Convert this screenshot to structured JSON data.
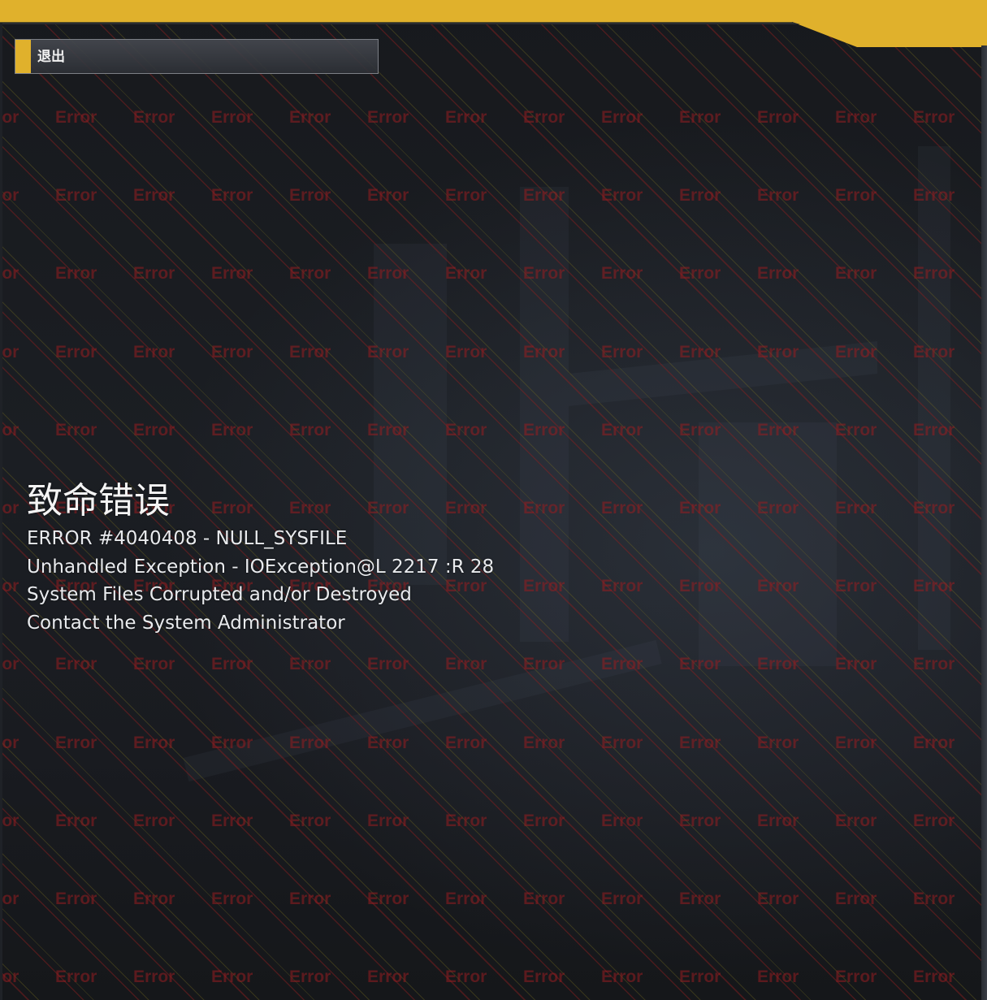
{
  "exit_button": {
    "label": "退出"
  },
  "error": {
    "title": "致命错误",
    "lines": [
      "ERROR #4040408 - NULL_SYSFILE",
      "Unhandled Exception - IOException@L 2217 :R 28",
      "System Files Corrupted and/or Destroyed",
      "Contact the System Administrator"
    ]
  },
  "background": {
    "watermark_text": "Error"
  },
  "colors": {
    "accent_yellow": "#e0b12c",
    "watermark_red": "#96201f",
    "background": "#17191d"
  }
}
